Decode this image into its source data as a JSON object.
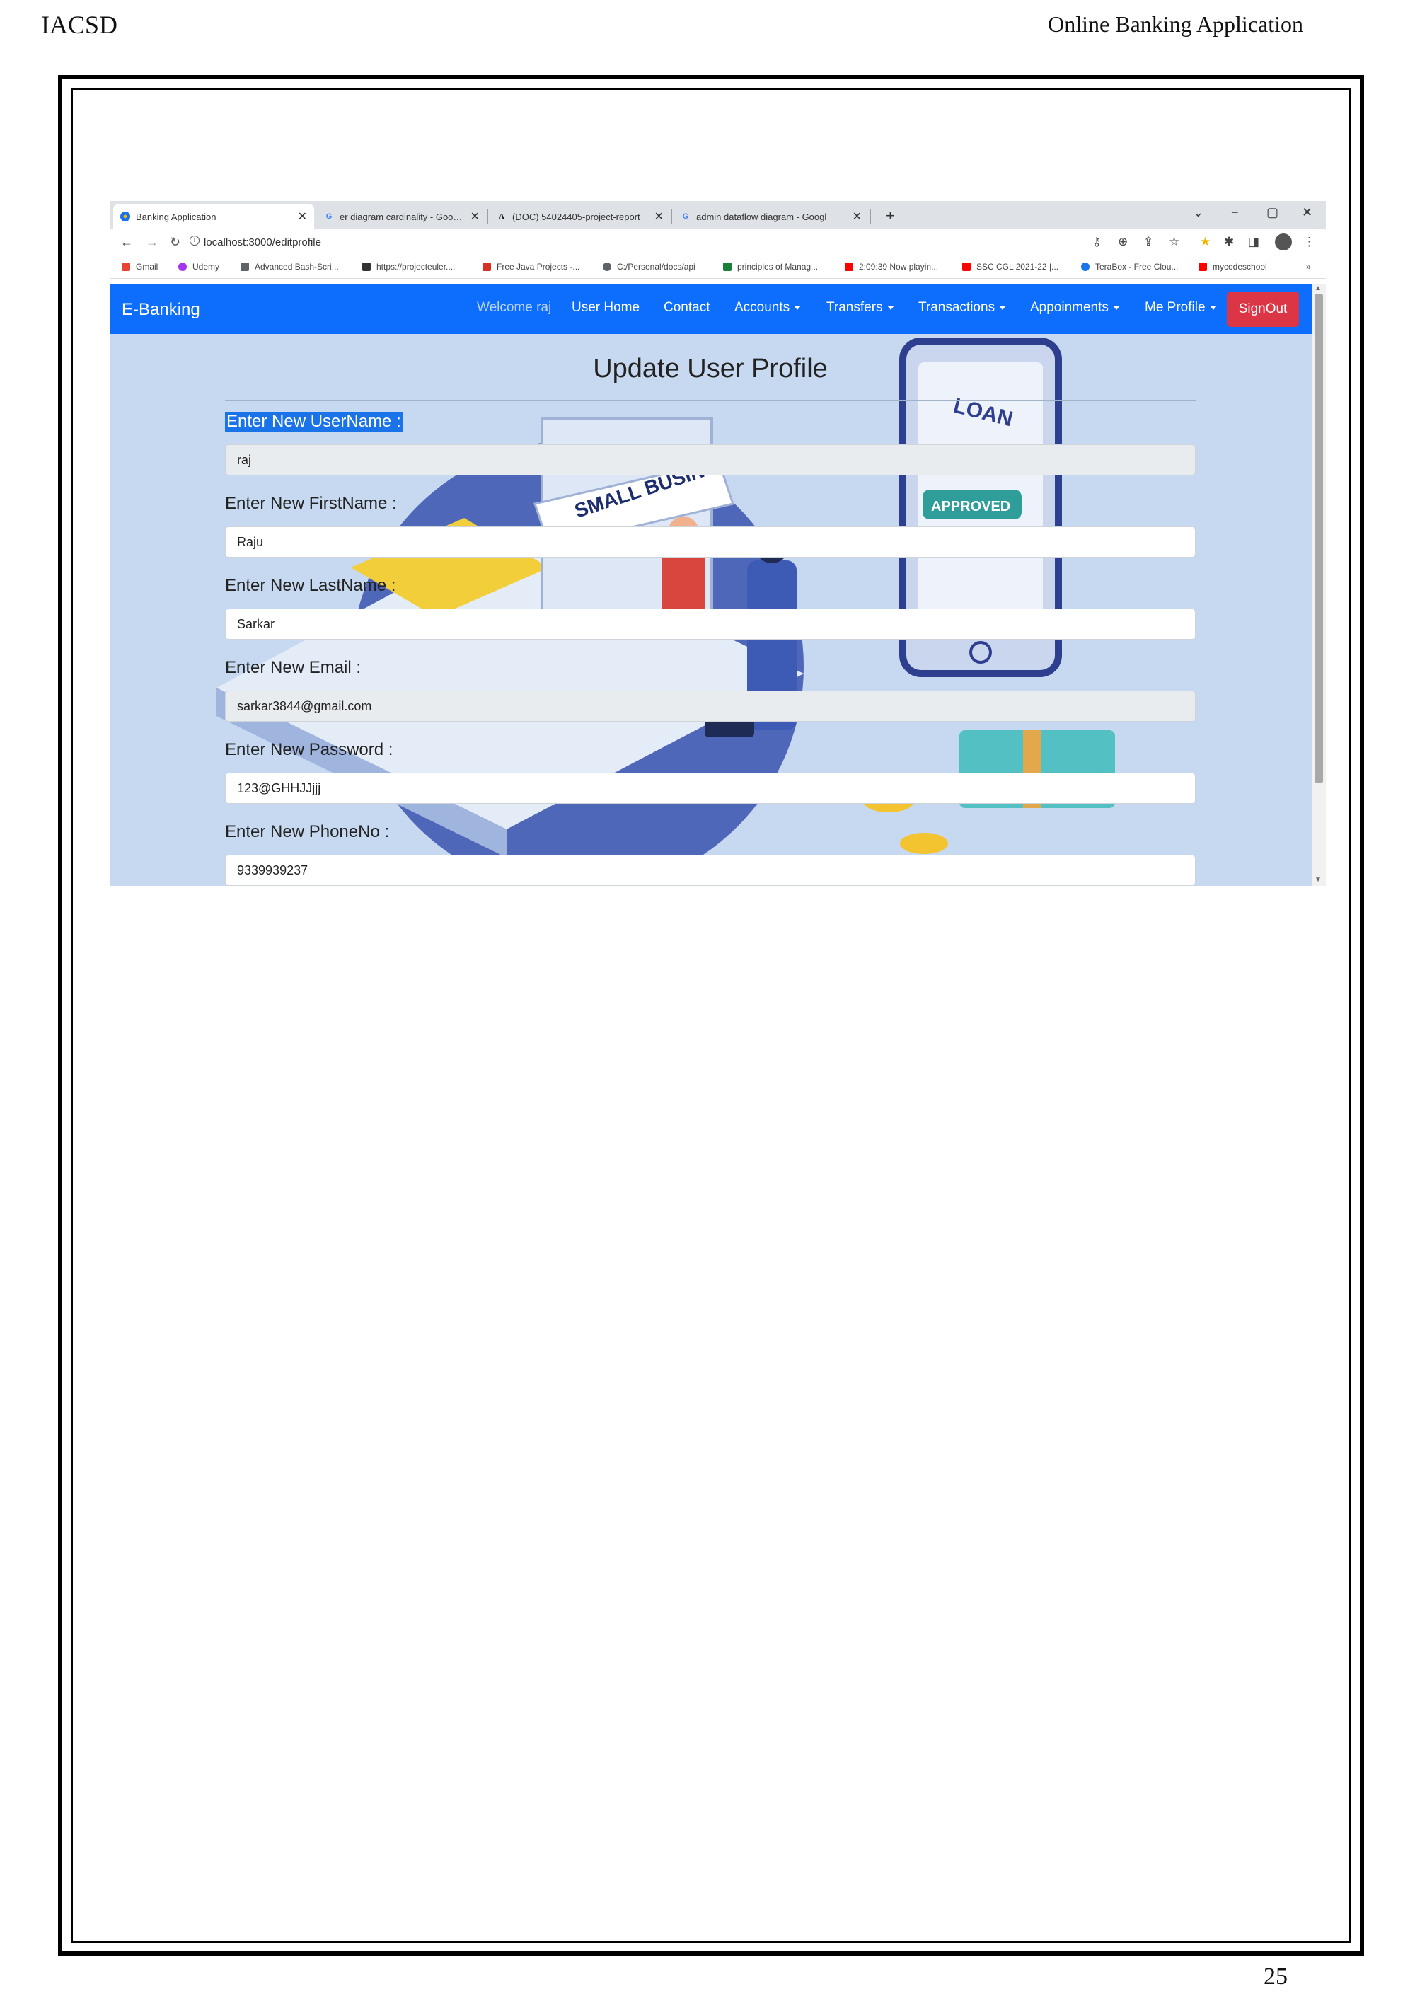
{
  "page": {
    "header_left": "IACSD",
    "header_right": "Online Banking Application",
    "page_number": "25"
  },
  "browser": {
    "tabs": [
      {
        "title": "Banking Application",
        "active": true
      },
      {
        "title": "er diagram cardinality - Google S",
        "active": false
      },
      {
        "title": "(DOC) 54024405-project-report",
        "active": false
      },
      {
        "title": "admin dataflow diagram - Googl",
        "active": false
      }
    ],
    "url": "localhost:3000/editprofile",
    "bookmarks": [
      {
        "label": "Gmail",
        "color": "#ea4335"
      },
      {
        "label": "Udemy",
        "color": "#a435f0"
      },
      {
        "label": "Advanced Bash-Scri...",
        "color": "#5f6368"
      },
      {
        "label": "https://projecteuler....",
        "color": "#333333"
      },
      {
        "label": "Free Java Projects -...",
        "color": "#d93025"
      },
      {
        "label": "C:/Personal/docs/api",
        "color": "#5f6368"
      },
      {
        "label": "principles of Manag...",
        "color": "#188038"
      },
      {
        "label": "2:09:39 Now playin...",
        "color": "#ff0000"
      },
      {
        "label": "SSC CGL 2021-22 |...",
        "color": "#ff0000"
      },
      {
        "label": "TeraBox - Free Clou...",
        "color": "#1a73e8"
      },
      {
        "label": "mycodeschool",
        "color": "#ff0000"
      }
    ],
    "bookmarks_more": "»"
  },
  "navbar": {
    "brand": "E-Banking",
    "welcome": "Welcome raj",
    "items": [
      "User Home",
      "Contact",
      "Accounts",
      "Transfers",
      "Transactions",
      "Appoinments",
      "Me Profile"
    ],
    "signout": "SignOut",
    "brand_color": "#0d6efd",
    "signout_color": "#dc3545"
  },
  "form": {
    "title": "Update User Profile",
    "fields": [
      {
        "label": "Enter New UserName :",
        "value": "raj",
        "readonly": true
      },
      {
        "label": "Enter New FirstName :",
        "value": "Raju",
        "readonly": false
      },
      {
        "label": "Enter New LastName :",
        "value": "Sarkar",
        "readonly": false
      },
      {
        "label": "Enter New Email :",
        "value": "sarkar3844@gmail.com",
        "readonly": true
      },
      {
        "label": "Enter New Password :",
        "value": "123@GHHJJjjj",
        "readonly": false
      },
      {
        "label": "Enter New PhoneNo :",
        "value": "9339939237",
        "readonly": false
      }
    ]
  },
  "illustration": {
    "sign_text": "SMALL BUSINESS",
    "phone_text": "LOAN",
    "stamp_text": "APPROVED"
  }
}
